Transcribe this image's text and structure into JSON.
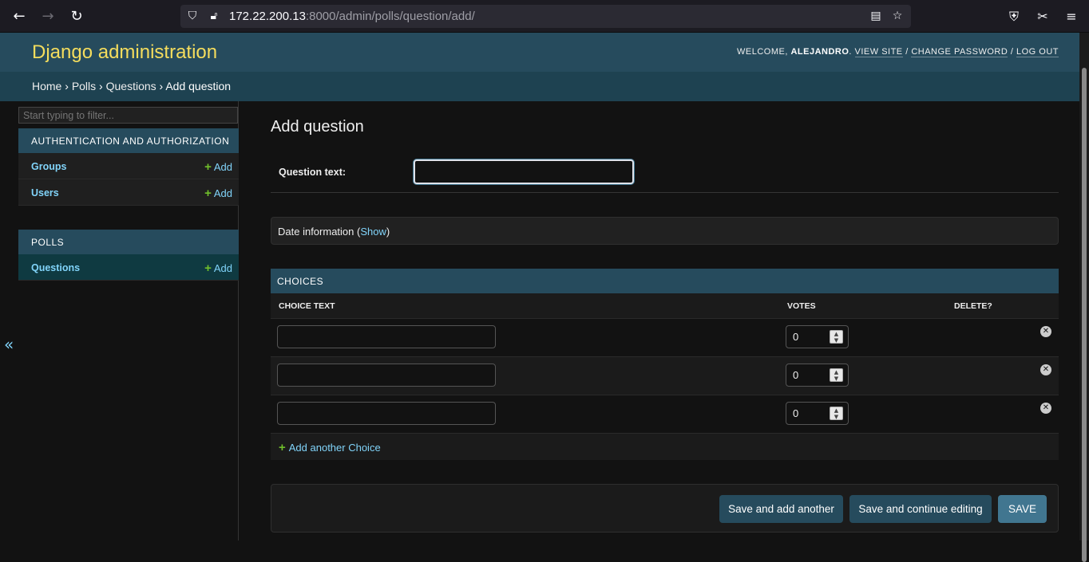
{
  "browser": {
    "url_host": "172.22.200.13",
    "url_rest": ":8000/admin/polls/question/add/"
  },
  "header": {
    "branding": "Django administration",
    "welcome": "WELCOME, ",
    "username": "ALEJANDRO",
    "view_site": "VIEW SITE",
    "change_password": "CHANGE PASSWORD",
    "log_out": "LOG OUT",
    "brand_color": "#f5dd5d",
    "header_color": "#264b5d"
  },
  "breadcrumbs": {
    "home": "Home",
    "polls": "Polls",
    "questions": "Questions",
    "current": "Add question",
    "separator": " › "
  },
  "sidebar": {
    "filter_placeholder": "Start typing to filter...",
    "modules": [
      {
        "caption": "AUTHENTICATION AND AUTHORIZATION",
        "models": [
          {
            "name": "Groups",
            "add": "Add"
          },
          {
            "name": "Users",
            "add": "Add"
          }
        ]
      },
      {
        "caption": "POLLS",
        "models": [
          {
            "name": "Questions",
            "add": "Add"
          }
        ]
      }
    ],
    "collapse_glyph": "«"
  },
  "main": {
    "title": "Add question",
    "question_label": "Question text:",
    "question_value": "",
    "date_info_prefix": "Date information (",
    "date_info_link": "Show",
    "date_info_suffix": ")",
    "inline": {
      "caption": "CHOICES",
      "headers": {
        "choice_text": "CHOICE TEXT",
        "votes": "VOTES",
        "delete": "DELETE?"
      },
      "rows": [
        {
          "choice_text": "",
          "votes": "0"
        },
        {
          "choice_text": "",
          "votes": "0"
        },
        {
          "choice_text": "",
          "votes": "0"
        }
      ],
      "add_another": "Add another Choice"
    },
    "buttons": {
      "save_add_another": "Save and add another",
      "save_continue": "Save and continue editing",
      "save": "SAVE"
    }
  }
}
